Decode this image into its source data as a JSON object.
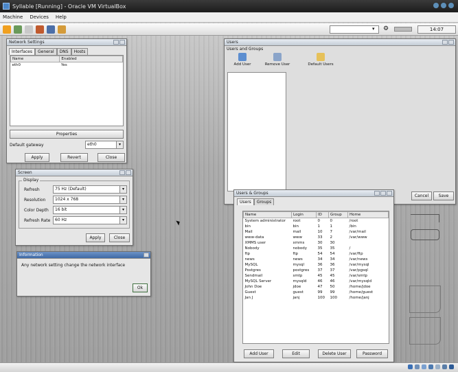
{
  "host": {
    "title": "Syllable [Running] - Oracle VM VirtualBox",
    "menu": [
      "Machine",
      "Devices",
      "Help"
    ]
  },
  "desktop": {
    "clock": "14:07"
  },
  "settings_window": {
    "title": "Network Settings",
    "tabs": [
      "Interfaces",
      "General",
      "DNS",
      "Hosts"
    ],
    "columns": [
      "Name",
      "Enabled"
    ],
    "rows": [
      [
        "eth0",
        "Yes"
      ]
    ],
    "properties_button": "Properties",
    "default_gateway_label": "Default gateway",
    "default_gateway_value": "eth0",
    "buttons": [
      "Apply",
      "Revert",
      "Close"
    ]
  },
  "screen_window": {
    "title": "Screen",
    "group_label": "Display",
    "rows": [
      {
        "label": "Refresh",
        "value": "75 Hz (Default)"
      },
      {
        "label": "Resolution",
        "value": "1024 x 768"
      },
      {
        "label": "Color Depth",
        "value": "16 bit"
      },
      {
        "label": "Refresh Rate",
        "value": "60 Hz"
      }
    ],
    "apply_button": "Apply",
    "close_button": "Close"
  },
  "info_dialog": {
    "title": "Information",
    "message": "Any network setting change the network interface",
    "ok_button": "Ok"
  },
  "users_window": {
    "title": "Users",
    "toolbar_label": "Users and Groups",
    "buttons": [
      "Add User",
      "Remove User",
      "Default Users"
    ]
  },
  "groups_window": {
    "title": "Users & Groups",
    "tabs": [
      "Users",
      "Groups"
    ],
    "columns": [
      "Name",
      "Login",
      "ID",
      "Group",
      "Home"
    ],
    "rows": [
      [
        "System administrator",
        "root",
        "0",
        "0",
        "/root"
      ],
      [
        "bin",
        "bin",
        "1",
        "1",
        "/bin"
      ],
      [
        "Mail",
        "mail",
        "10",
        "7",
        "/var/mail"
      ],
      [
        "www-data",
        "www",
        "33",
        "2",
        "/var/www"
      ],
      [
        "XMMS user",
        "xmms",
        "30",
        "30",
        ""
      ],
      [
        "Nobody",
        "nobody",
        "35",
        "35",
        "/"
      ],
      [
        "ftp",
        "ftp",
        "54",
        "54",
        "/var/ftp"
      ],
      [
        "news",
        "news",
        "34",
        "34",
        "/var/news"
      ],
      [
        "MySQL",
        "mysql",
        "36",
        "36",
        "/var/mysql"
      ],
      [
        "Postgres",
        "postgres",
        "37",
        "37",
        "/var/pgsql"
      ],
      [
        "Sendmail",
        "smtp",
        "45",
        "45",
        "/var/smtp"
      ],
      [
        "MySQL Server",
        "mysqld",
        "46",
        "46",
        "/var/mysqld"
      ],
      [
        "John Doe",
        "jdoe",
        "47",
        "50",
        "/home/jdoe"
      ],
      [
        "Guest",
        "guest",
        "99",
        "99",
        "/home/guest"
      ],
      [
        "Jan J",
        "janj",
        "100",
        "100",
        "/home/janj"
      ]
    ],
    "buttons": [
      "Add User",
      "Edit",
      "Delete User",
      "Password"
    ],
    "cancel_button": "Cancel",
    "save_button": "Save"
  }
}
